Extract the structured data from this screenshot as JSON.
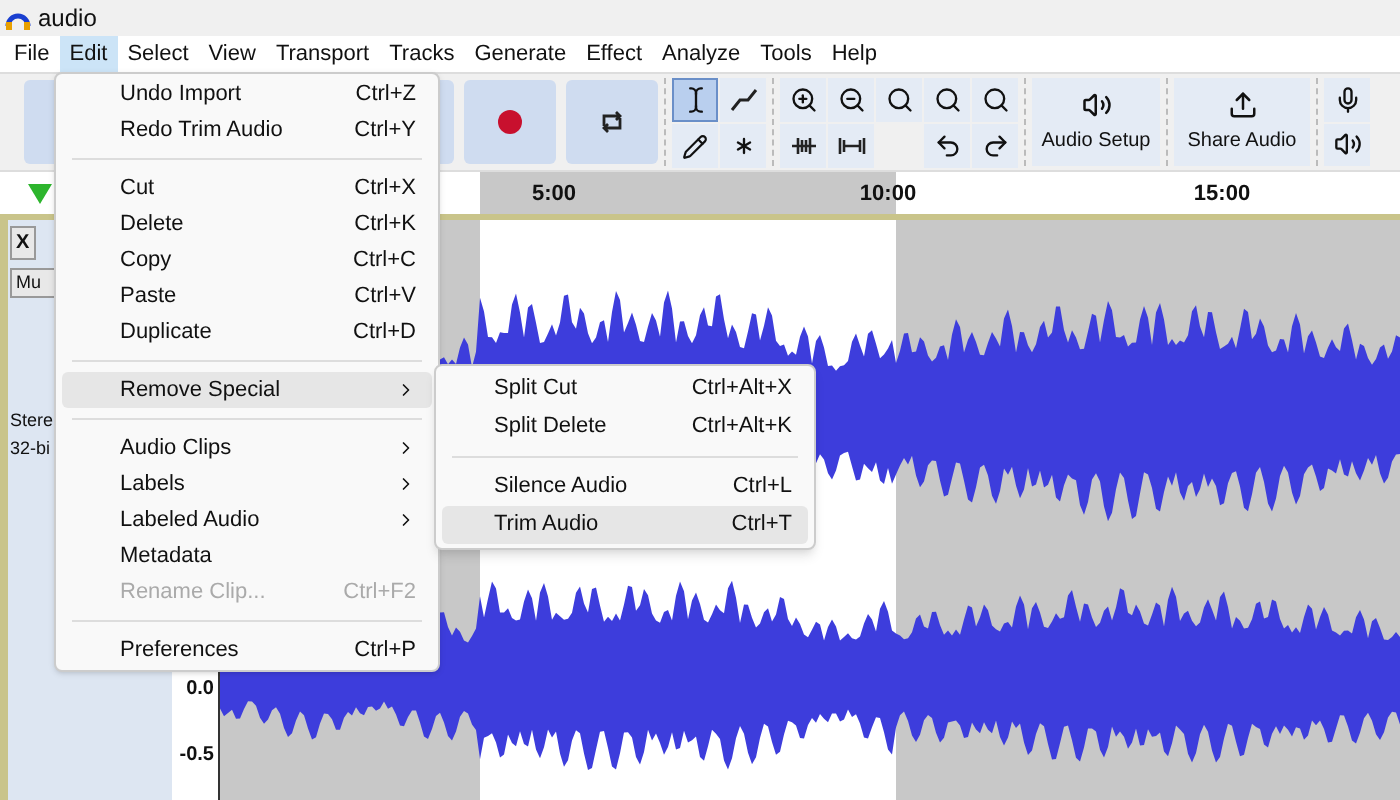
{
  "window": {
    "title": "audio"
  },
  "menu_bar": [
    {
      "label": "File",
      "selected": false
    },
    {
      "label": "Edit",
      "selected": true
    },
    {
      "label": "Select",
      "selected": false
    },
    {
      "label": "View",
      "selected": false
    },
    {
      "label": "Transport",
      "selected": false
    },
    {
      "label": "Tracks",
      "selected": false
    },
    {
      "label": "Generate",
      "selected": false
    },
    {
      "label": "Effect",
      "selected": false
    },
    {
      "label": "Analyze",
      "selected": false
    },
    {
      "label": "Tools",
      "selected": false
    },
    {
      "label": "Help",
      "selected": false
    }
  ],
  "tools": [
    {
      "kind": "select",
      "selected": true
    },
    {
      "kind": "envelope",
      "selected": false
    },
    {
      "kind": "draw",
      "selected": false
    },
    {
      "kind": "multi",
      "selected": false
    }
  ],
  "audio_setup": "Audio Setup",
  "share_audio": "Share Audio",
  "ruler": [
    "5:00",
    "10:00",
    "15:00"
  ],
  "track": {
    "close": "X",
    "mute": "Mu",
    "info": [
      "Stere",
      "32-bi"
    ],
    "scale": [
      "0.0",
      "-0.5"
    ]
  },
  "edit_menu": [
    {
      "kind": "item",
      "label": "Undo Import",
      "shortcut": "Ctrl+Z",
      "disabled": false,
      "selected": false
    },
    {
      "kind": "item",
      "label": "Redo Trim Audio",
      "shortcut": "Ctrl+Y",
      "disabled": false,
      "selected": false
    },
    {
      "kind": "separator"
    },
    {
      "kind": "item",
      "label": "Cut",
      "shortcut": "Ctrl+X",
      "disabled": false,
      "selected": false
    },
    {
      "kind": "item",
      "label": "Delete",
      "shortcut": "Ctrl+K",
      "disabled": false,
      "selected": false
    },
    {
      "kind": "item",
      "label": "Copy",
      "shortcut": "Ctrl+C",
      "disabled": false,
      "selected": false
    },
    {
      "kind": "item",
      "label": "Paste",
      "shortcut": "Ctrl+V",
      "disabled": false,
      "selected": false
    },
    {
      "kind": "item",
      "label": "Duplicate",
      "shortcut": "Ctrl+D",
      "disabled": false,
      "selected": false
    },
    {
      "kind": "separator"
    },
    {
      "kind": "submenu",
      "label": "Remove Special",
      "disabled": false,
      "selected": true
    },
    {
      "kind": "separator"
    },
    {
      "kind": "submenu",
      "label": "Audio Clips",
      "disabled": false,
      "selected": false
    },
    {
      "kind": "submenu",
      "label": "Labels",
      "disabled": false,
      "selected": false
    },
    {
      "kind": "submenu",
      "label": "Labeled Audio",
      "disabled": false,
      "selected": false
    },
    {
      "kind": "item",
      "label": "Metadata",
      "disabled": false,
      "selected": false
    },
    {
      "kind": "item",
      "label": "Rename Clip...",
      "shortcut": "Ctrl+F2",
      "disabled": true,
      "selected": false
    },
    {
      "kind": "separator"
    },
    {
      "kind": "item",
      "label": "Preferences",
      "shortcut": "Ctrl+P",
      "disabled": false,
      "selected": false
    }
  ],
  "submenu": [
    {
      "kind": "item",
      "label": "Split Cut",
      "shortcut": "Ctrl+Alt+X",
      "selected": false
    },
    {
      "kind": "item",
      "label": "Split Delete",
      "shortcut": "Ctrl+Alt+K",
      "selected": false
    },
    {
      "kind": "separator"
    },
    {
      "kind": "item",
      "label": "Silence Audio",
      "shortcut": "Ctrl+L",
      "selected": false
    },
    {
      "kind": "item",
      "label": "Trim Audio",
      "shortcut": "Ctrl+T",
      "selected": true
    }
  ]
}
